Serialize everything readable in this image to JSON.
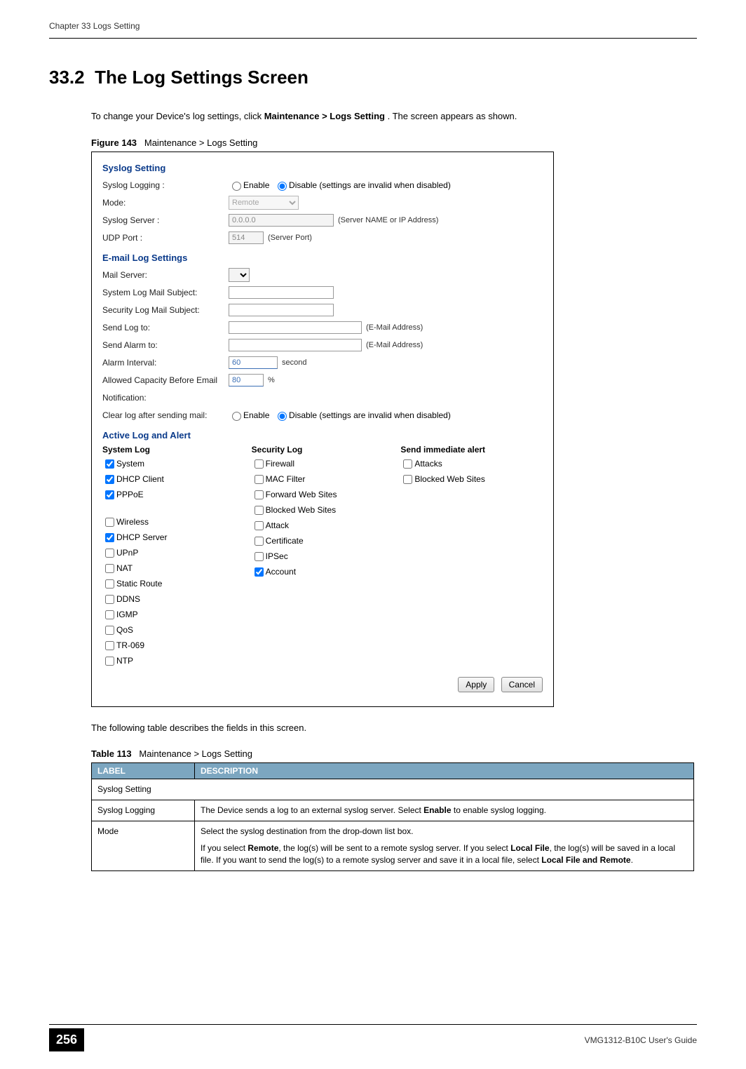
{
  "header": {
    "running": "Chapter 33 Logs Setting"
  },
  "section": {
    "number": "33.2",
    "title": "The Log Settings Screen",
    "intro_a": "To change your Device's log settings, click ",
    "intro_b": "Maintenance > Logs Setting",
    "intro_c": ". The screen appears as shown."
  },
  "figure": {
    "caption_label": "Figure 143",
    "caption_text": "Maintenance > Logs Setting",
    "syslog": {
      "heading": "Syslog Setting",
      "logging_label": "Syslog Logging :",
      "enable": "Enable",
      "disable": "Disable (settings are invalid when disabled)",
      "mode_label": "Mode:",
      "mode_value": "Remote",
      "server_label": "Syslog Server :",
      "server_value": "0.0.0.0",
      "server_note": "(Server NAME or IP Address)",
      "udp_label": "UDP Port :",
      "udp_value": "514",
      "udp_note": "(Server Port)"
    },
    "email": {
      "heading": "E-mail Log Settings",
      "mail_server": "Mail Server:",
      "sys_subject": "System Log Mail Subject:",
      "sec_subject": "Security Log Mail Subject:",
      "send_log": "Send Log to:",
      "send_alarm": "Send Alarm to:",
      "email_note": "(E-Mail Address)",
      "alarm_interval": "Alarm Interval:",
      "alarm_value": "60",
      "alarm_unit": "second",
      "capacity_label_a": "Allowed Capacity Before Email",
      "capacity_label_b": "Notification:",
      "capacity_value": "80",
      "capacity_unit": "%",
      "clear_label": "Clear log after sending mail:",
      "enable": "Enable",
      "disable": "Disable (settings are invalid when disabled)"
    },
    "active": {
      "heading": "Active Log and Alert",
      "col1_head": "System Log",
      "col2_head": "Security Log",
      "col3_head": "Send immediate alert",
      "col1": [
        {
          "label": "System",
          "checked": true
        },
        {
          "label": "DHCP Client",
          "checked": true
        },
        {
          "label": "PPPoE",
          "checked": true
        },
        {
          "label": "",
          "checked": false,
          "spacer": true
        },
        {
          "label": "Wireless",
          "checked": false
        },
        {
          "label": "DHCP Server",
          "checked": true
        },
        {
          "label": "UPnP",
          "checked": false
        },
        {
          "label": "NAT",
          "checked": false
        },
        {
          "label": "Static Route",
          "checked": false
        },
        {
          "label": "DDNS",
          "checked": false
        },
        {
          "label": "IGMP",
          "checked": false
        },
        {
          "label": "QoS",
          "checked": false
        },
        {
          "label": "TR-069",
          "checked": false
        },
        {
          "label": "NTP",
          "checked": false
        }
      ],
      "col2": [
        {
          "label": "Firewall",
          "checked": false
        },
        {
          "label": "MAC Filter",
          "checked": false
        },
        {
          "label": "Forward Web Sites",
          "checked": false
        },
        {
          "label": "Blocked Web Sites",
          "checked": false
        },
        {
          "label": "Attack",
          "checked": false
        },
        {
          "label": "Certificate",
          "checked": false
        },
        {
          "label": "IPSec",
          "checked": false
        },
        {
          "label": "Account",
          "checked": true
        }
      ],
      "col3": [
        {
          "label": "Attacks",
          "checked": false
        },
        {
          "label": "Blocked Web Sites",
          "checked": false
        }
      ]
    },
    "buttons": {
      "apply": "Apply",
      "cancel": "Cancel"
    }
  },
  "after_figure": "The following table describes the fields in this screen.",
  "table": {
    "caption_label": "Table 113",
    "caption_text": "Maintenance > Logs Setting",
    "head_label": "LABEL",
    "head_desc": "DESCRIPTION",
    "rows": [
      {
        "label": "Syslog Setting",
        "desc": "",
        "span": true
      },
      {
        "label": "Syslog Logging",
        "desc_a": "The Device sends a log to an external syslog server. Select ",
        "desc_b": "Enable",
        "desc_c": " to enable syslog logging."
      },
      {
        "label": "Mode",
        "p1": "Select the syslog destination from the drop-down list box.",
        "p2_a": "If you select ",
        "p2_b": "Remote",
        "p2_c": ", the log(s) will be sent to a remote syslog server. If you select ",
        "p2_d": "Local File",
        "p2_e": ", the log(s) will be saved in a local file. If you want to send the log(s) to a remote syslog server and save it in a local file, select ",
        "p2_f": "Local File and Remote",
        "p2_g": "."
      }
    ]
  },
  "footer": {
    "page": "256",
    "guide": "VMG1312-B10C User's Guide"
  }
}
